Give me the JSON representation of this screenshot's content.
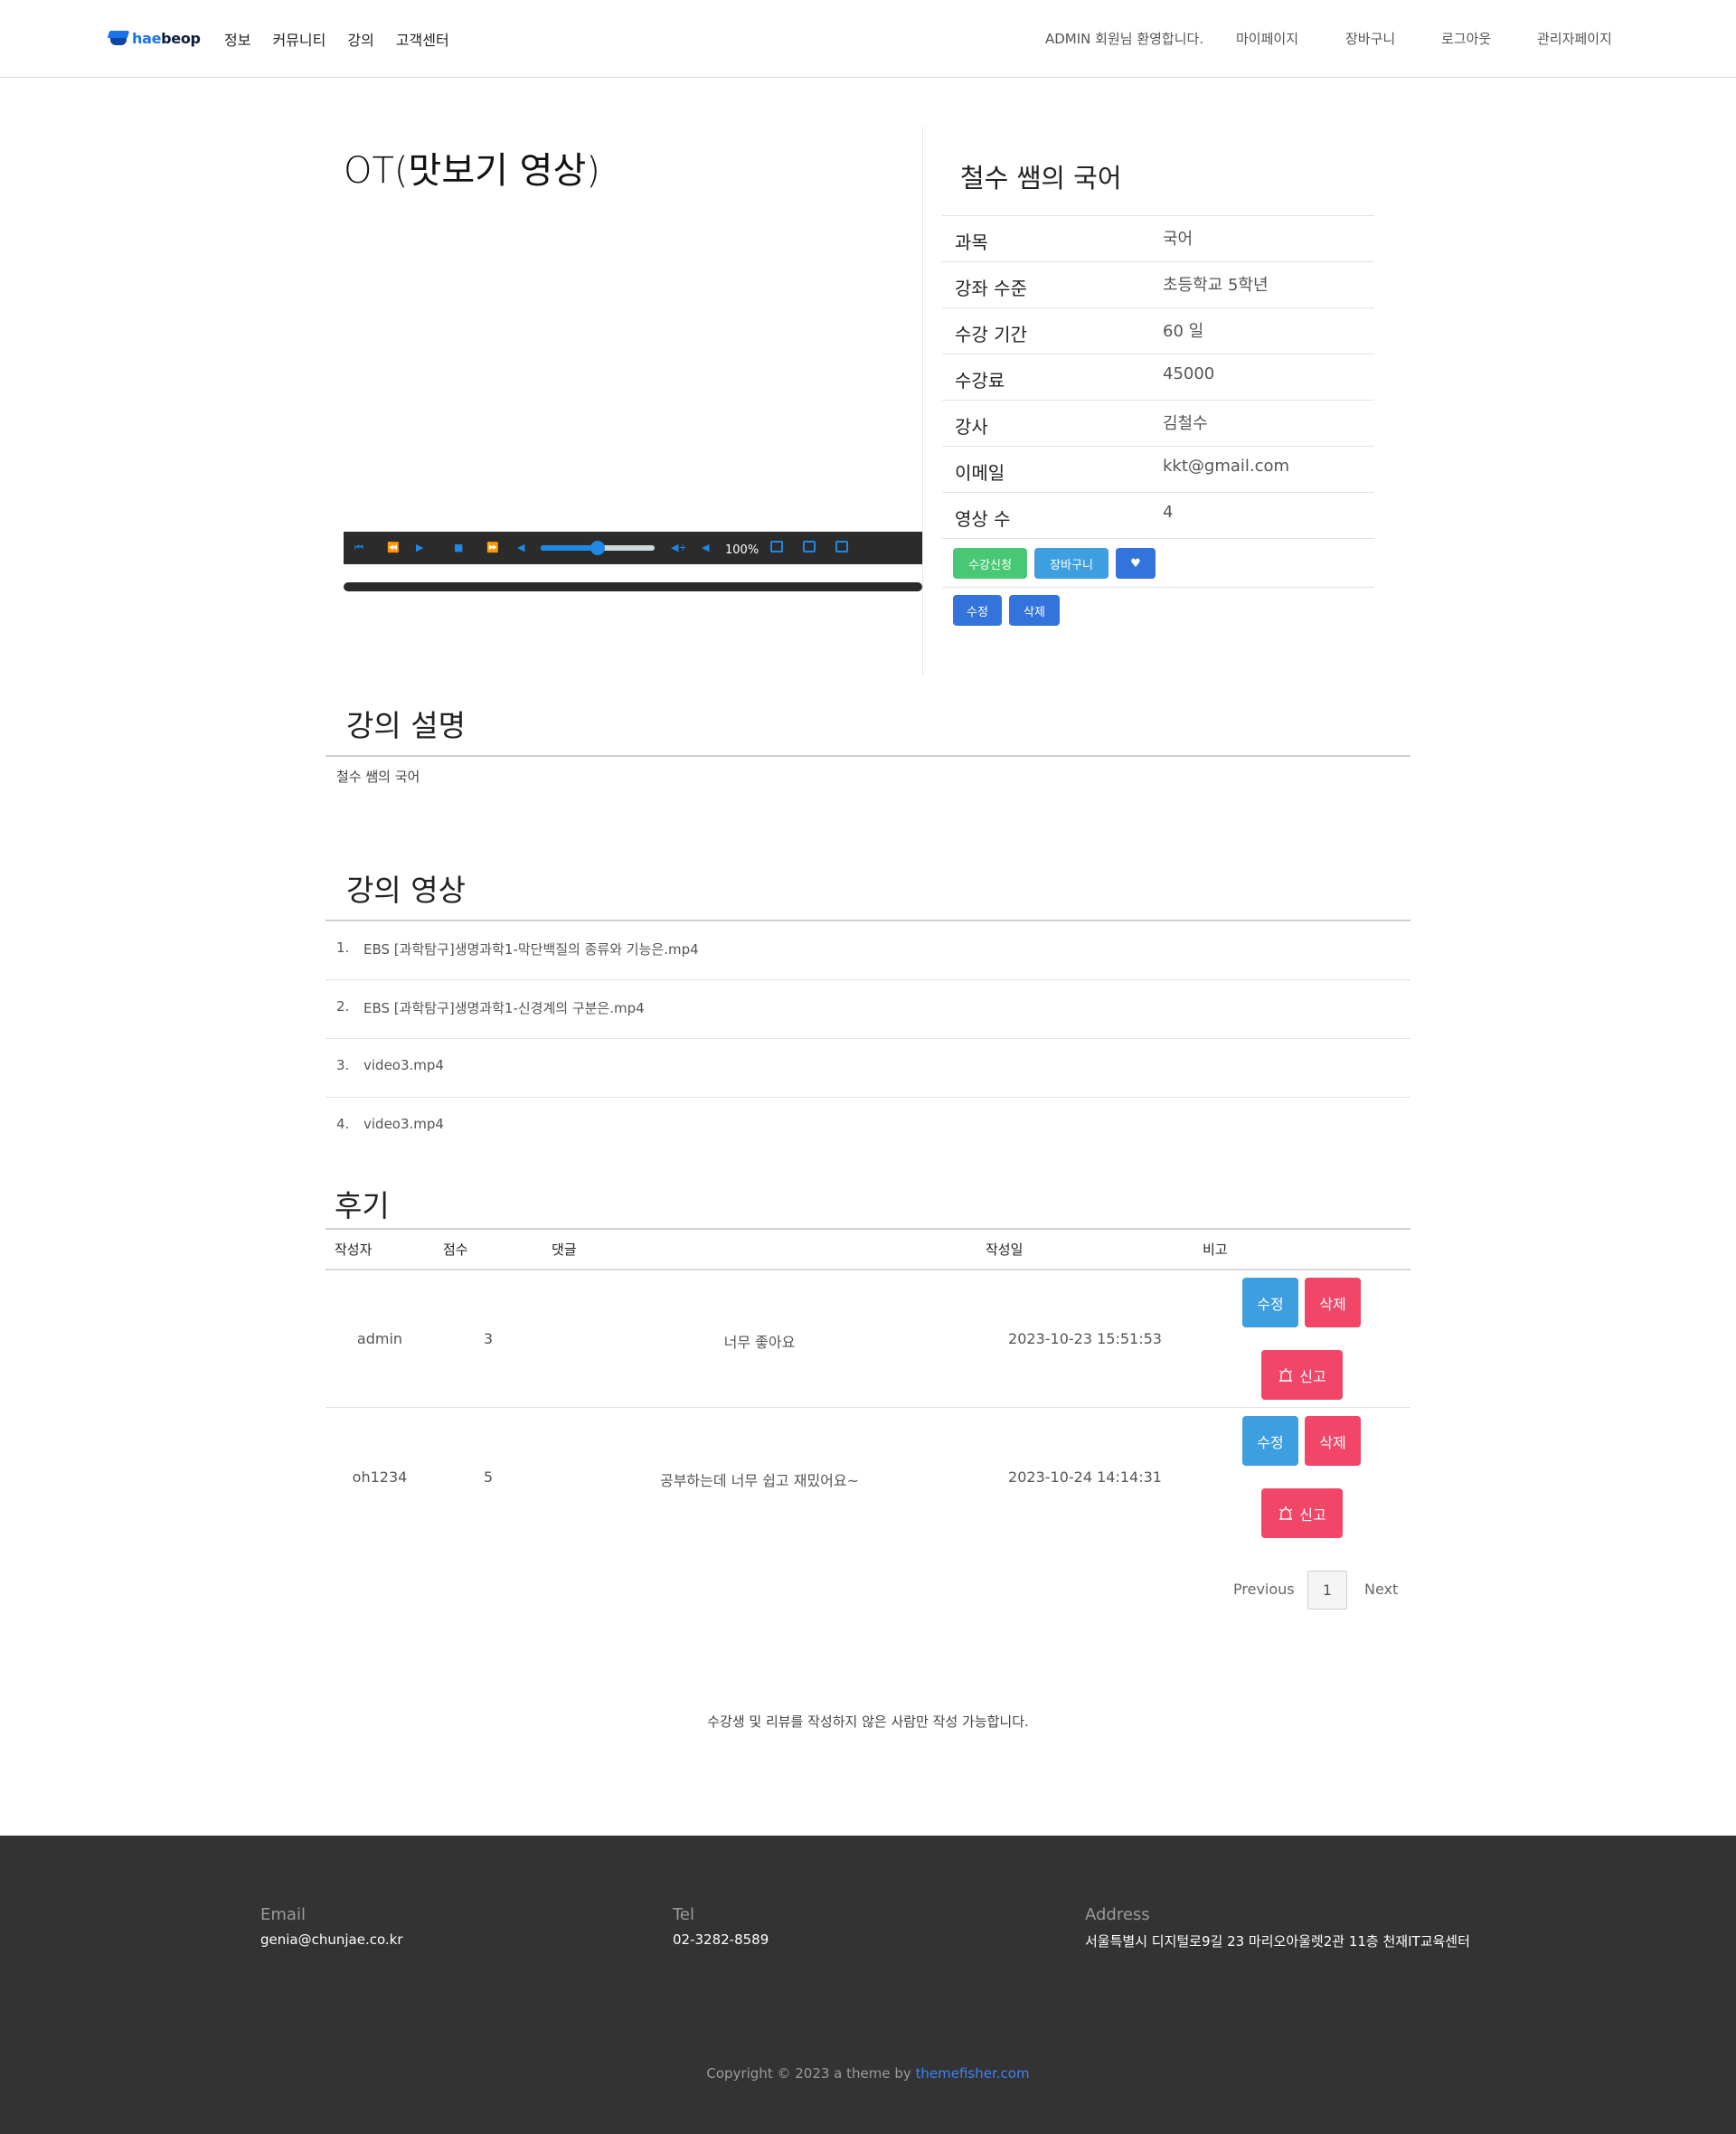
{
  "header": {
    "logo_text_a": "hae",
    "logo_text_b": "beop",
    "nav_left": [
      "정보",
      "커뮤니티",
      "강의",
      "고객센터"
    ],
    "welcome": "ADMIN 회원님 환영합니다.",
    "mypage": "마이페이지",
    "cart": "장바구니",
    "logout": "로그아웃",
    "admin": "관리자페이지"
  },
  "video": {
    "title": "OT(맛보기 영상)",
    "zoom": "100%",
    "volume_fraction": 0.5
  },
  "course": {
    "title": "철수 쌤의 국어",
    "info": [
      {
        "key": "과목",
        "value": "국어"
      },
      {
        "key": "강좌 수준",
        "value": "초등학교 5학년"
      },
      {
        "key": "수강 기간",
        "value": "60 일"
      },
      {
        "key": "수강료",
        "value": "45000"
      },
      {
        "key": "강사",
        "value": "김철수"
      },
      {
        "key": "이메일",
        "value": "kkt@gmail.com"
      },
      {
        "key": "영상 수",
        "value": "4"
      }
    ],
    "enroll_label": "수강신청",
    "cart_label": "장바구니",
    "like_icon": "♥",
    "edit_label": "수정",
    "delete_label": "삭제"
  },
  "description": {
    "title": "강의 설명",
    "text": "철수 쌤의 국어"
  },
  "videos": {
    "title": "강의 영상",
    "items": [
      {
        "num": "1.",
        "name": "EBS [과학탐구]생명과학1-막단백질의 종류와 기능은.mp4"
      },
      {
        "num": "2.",
        "name": "EBS [과학탐구]생명과학1-신경계의 구분은.mp4"
      },
      {
        "num": "3.",
        "name": "video3.mp4"
      },
      {
        "num": "4.",
        "name": "video3.mp4"
      }
    ]
  },
  "reviews": {
    "title": "후기",
    "headers": [
      "작성자",
      "점수",
      "댓글",
      "작성일",
      "비고"
    ],
    "rows": [
      {
        "author": "admin",
        "score": "3",
        "comment": "너무 좋아요",
        "date": "2023-10-23 15:51:53"
      },
      {
        "author": "oh1234",
        "score": "5",
        "comment": "공부하는데 너무 쉽고 재밌어요~",
        "date": "2023-10-24 14:14:31"
      }
    ],
    "edit_label": "수정",
    "delete_label": "삭제",
    "report_label": "신고",
    "pager": {
      "prev": "Previous",
      "page": "1",
      "next": "Next"
    },
    "notice": "수강생 및 리뷰를 작성하지 않은 사람만 작성 가능합니다."
  },
  "footer": {
    "email_label": "Email",
    "email": "genia@chunjae.co.kr",
    "tel_label": "Tel",
    "tel": "02-3282-8589",
    "address_label": "Address",
    "address": "서울특별시 디지털로9길 23 마리오아울렛2관 11층 천재IT교육센터",
    "copyright_prefix": "Copyright © 2023 a theme by ",
    "copyright_link": "themefisher.com"
  },
  "colors": {
    "primary_blue": "#3273dc",
    "cyan": "#3e9fe0",
    "green": "#48c774",
    "red": "#f14668",
    "footer_bg": "#333333"
  }
}
